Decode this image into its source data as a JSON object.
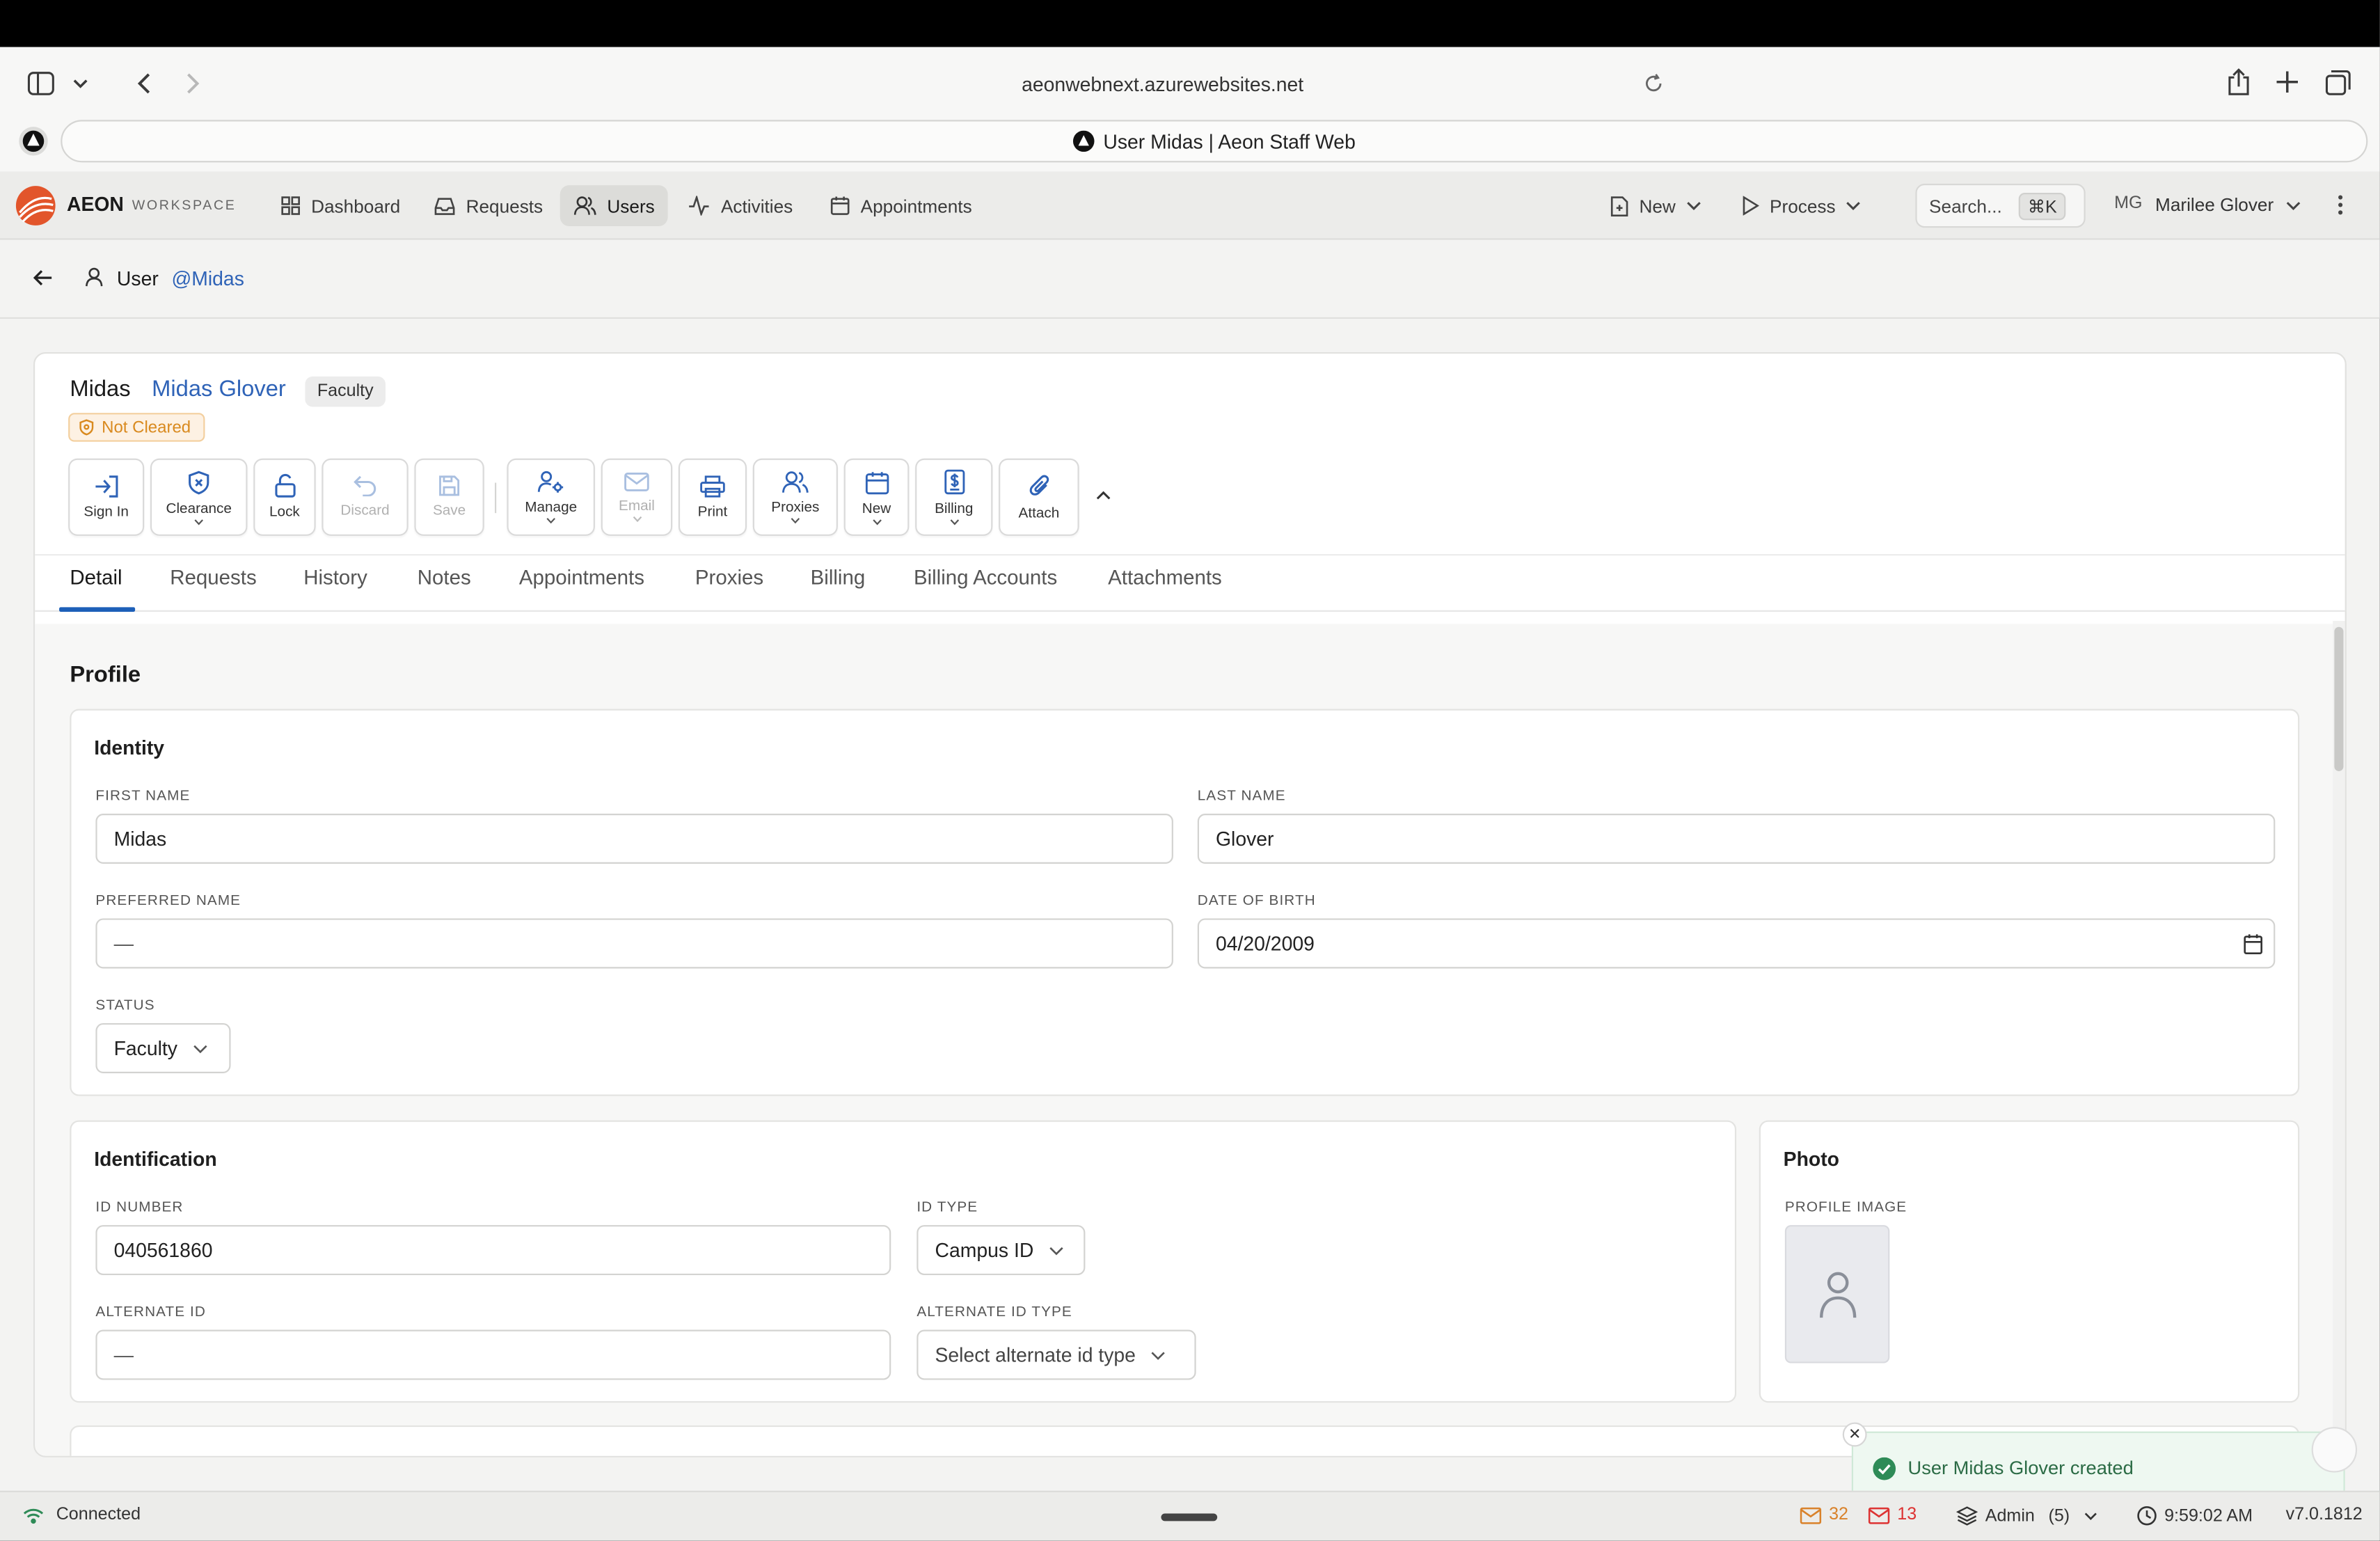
{
  "browser": {
    "url": "aeonwebnext.azurewebsites.net",
    "tab_title": "User Midas | Aeon Staff Web"
  },
  "nav": {
    "brand": "AEON",
    "brand_sub": "WORKSPACE",
    "items": [
      {
        "label": "Dashboard",
        "icon": "grid-icon"
      },
      {
        "label": "Requests",
        "icon": "inbox-icon"
      },
      {
        "label": "Users",
        "icon": "users-icon"
      },
      {
        "label": "Activities",
        "icon": "activity-icon"
      },
      {
        "label": "Appointments",
        "icon": "calendar-icon"
      }
    ],
    "new_label": "New",
    "process_label": "Process",
    "search_placeholder": "Search...",
    "search_shortcut": "⌘K",
    "user_initials": "MG",
    "user_name": "Marilee Glover"
  },
  "breadcrumb": {
    "label": "User",
    "handle": "@Midas"
  },
  "record": {
    "username": "Midas",
    "full_name": "Midas Glover",
    "type_badge": "Faculty",
    "status_badge": "Not Cleared"
  },
  "toolbar": {
    "sign_in": "Sign In",
    "clearance": "Clearance",
    "lock": "Lock",
    "discard": "Discard",
    "save": "Save",
    "manage": "Manage",
    "email": "Email",
    "print": "Print",
    "proxies": "Proxies",
    "new": "New",
    "billing": "Billing",
    "attach": "Attach"
  },
  "tabs": [
    "Detail",
    "Requests",
    "History",
    "Notes",
    "Appointments",
    "Proxies",
    "Billing",
    "Billing Accounts",
    "Attachments"
  ],
  "profile": {
    "title": "Profile",
    "identity": {
      "title": "Identity",
      "first_name_label": "FIRST NAME",
      "first_name": "Midas",
      "last_name_label": "LAST NAME",
      "last_name": "Glover",
      "preferred_name_label": "PREFERRED NAME",
      "preferred_name": "—",
      "dob_label": "DATE OF BIRTH",
      "dob": "04/20/2009",
      "status_label": "STATUS",
      "status": "Faculty"
    },
    "identification": {
      "title": "Identification",
      "id_number_label": "ID NUMBER",
      "id_number": "040561860",
      "id_type_label": "ID TYPE",
      "id_type": "Campus ID",
      "alt_id_label": "ALTERNATE ID",
      "alt_id": "—",
      "alt_id_type_label": "ALTERNATE ID TYPE",
      "alt_id_type": "Select alternate id type"
    },
    "photo": {
      "title": "Photo",
      "label": "PROFILE IMAGE"
    }
  },
  "toast": {
    "message": "User Midas Glover created"
  },
  "statusbar": {
    "connection": "Connected",
    "mail_count_1": "32",
    "mail_count_2": "13",
    "role": "Admin",
    "role_count": "(5)",
    "time": "9:59:02 AM",
    "version": "v7.0.1812"
  },
  "colors": {
    "accent": "#1d5fb8",
    "link": "#2f63b7",
    "warning": "#d98a1f",
    "success": "#2b6b45",
    "danger": "#d33"
  }
}
